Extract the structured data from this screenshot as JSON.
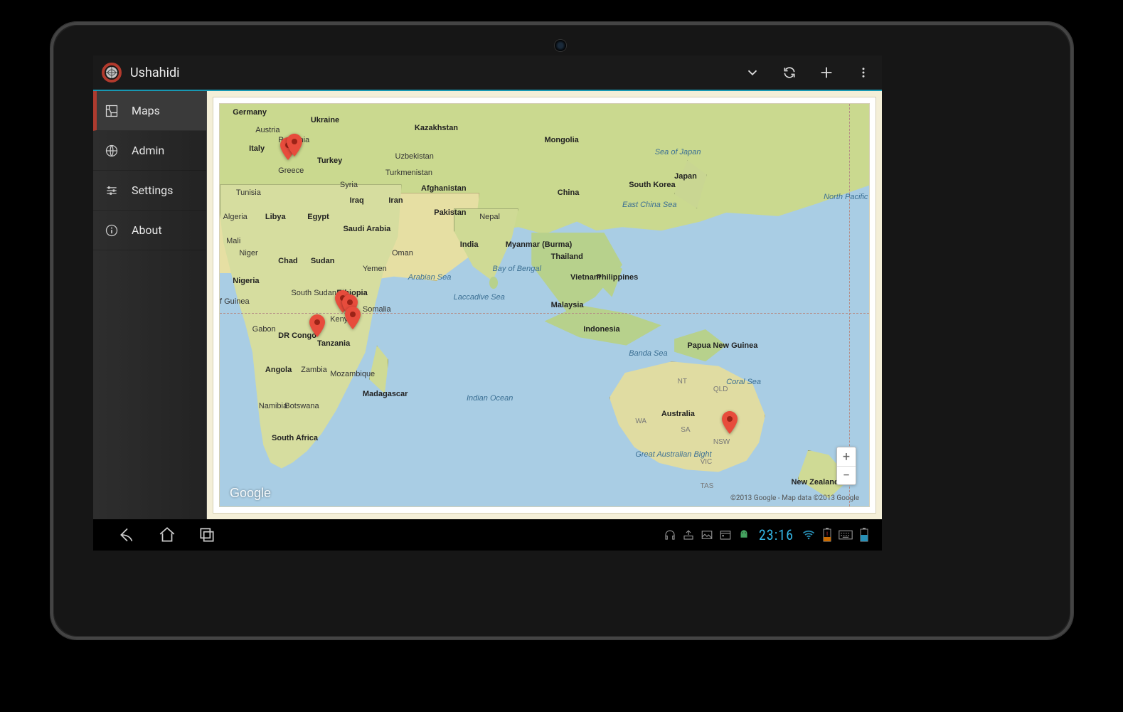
{
  "actionbar": {
    "title": "Ushahidi"
  },
  "sidebar": {
    "items": [
      {
        "label": "Maps"
      },
      {
        "label": "Admin"
      },
      {
        "label": "Settings"
      },
      {
        "label": "About"
      }
    ]
  },
  "map": {
    "logo": "Google",
    "attribution": "©2013 Google - Map data ©2013 Google",
    "countries": {
      "germany": "Germany",
      "ukraine": "Ukraine",
      "austria": "Austria",
      "romania": "Romania",
      "italy": "Italy",
      "greece": "Greece",
      "turkey": "Turkey",
      "syria": "Syria",
      "iraq": "Iraq",
      "iran": "Iran",
      "tunisia": "Tunisia",
      "algeria": "Algeria",
      "libya": "Libya",
      "egypt": "Egypt",
      "saudi": "Saudi Arabia",
      "oman": "Oman",
      "yemen": "Yemen",
      "niger": "Niger",
      "mali": "Mali",
      "chad": "Chad",
      "sudan": "Sudan",
      "nigeria": "Nigeria",
      "s_sudan": "South Sudan",
      "ethiopia": "Ethiopia",
      "somalia": "Somalia",
      "kenya": "Kenya",
      "gabon": "Gabon",
      "drc": "DR Congo",
      "tanzania": "Tanzania",
      "angola": "Angola",
      "zambia": "Zambia",
      "mozambique": "Mozambique",
      "madagascar": "Madagascar",
      "botswana": "Botswana",
      "namibia": "Namibia",
      "s_africa": "South Africa",
      "kazakhstan": "Kazakhstan",
      "uzbekistan": "Uzbekistan",
      "turkmenistan": "Turkmenistan",
      "afghanistan": "Afghanistan",
      "pakistan": "Pakistan",
      "india": "India",
      "nepal": "Nepal",
      "myanmar": "Myanmar (Burma)",
      "thailand": "Thailand",
      "vietnam": "Vietnam",
      "mongolia": "Mongolia",
      "china": "China",
      "s_korea": "South Korea",
      "japan": "Japan",
      "philippines": "Philippines",
      "malaysia": "Malaysia",
      "indonesia": "Indonesia",
      "png": "Papua New Guinea",
      "australia": "Australia",
      "nz": "New Zealand",
      "f_guinea": "f Guinea"
    },
    "seas": {
      "arabian": "Arabian Sea",
      "bengal": "Bay of Bengal",
      "laccadive": "Laccadive Sea",
      "indian": "Indian Ocean",
      "e_china": "East China Sea",
      "s_japan": "Sea of Japan",
      "coral": "Coral Sea",
      "banda": "Banda Sea",
      "gab": "Great Australian Bight",
      "n_pacific": "North Pacific Ocean"
    },
    "aus_states": {
      "nt": "NT",
      "qld": "QLD",
      "wa": "WA",
      "sa": "SA",
      "nsw": "NSW",
      "vic": "VIC",
      "tas": "TAS"
    }
  },
  "status": {
    "time": "23:16"
  }
}
